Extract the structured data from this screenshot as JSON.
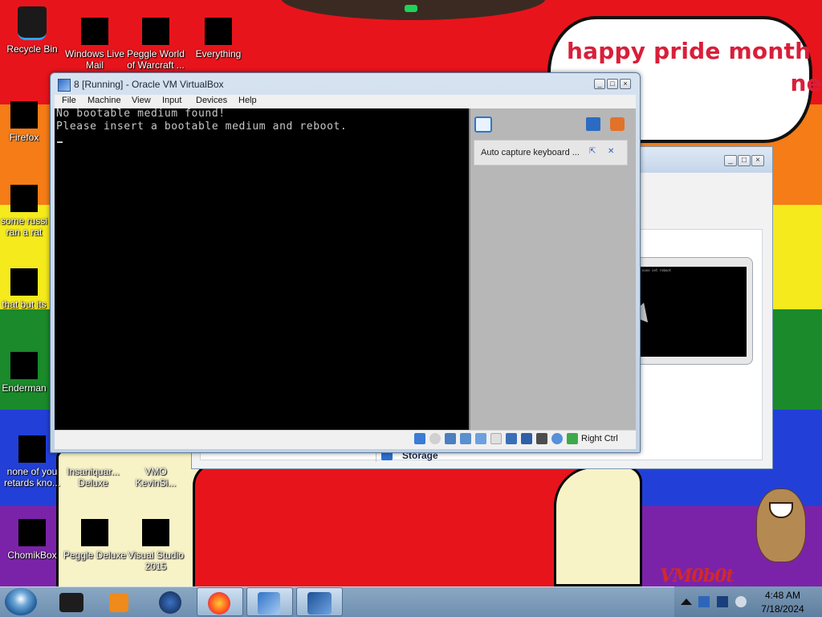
{
  "wallpaper": {
    "speech_bubble": "happy pride month\n                            ne!",
    "watermark": "VM0b0t"
  },
  "desktop_icons": [
    {
      "label": "Recycle Bin",
      "icon": "recycle-bin-icon"
    },
    {
      "label": "Windows Live\nMail",
      "icon": "mail-icon"
    },
    {
      "label": "Peggle World\nof Warcraft ...",
      "icon": "peggle-icon"
    },
    {
      "label": "Everything",
      "icon": "search-icon"
    },
    {
      "label": "Firefox",
      "icon": "firefox-icon"
    },
    {
      "label": "some russi\nran a rat",
      "icon": "shortcut-icon"
    },
    {
      "label": "that but its",
      "icon": "shortcut-icon"
    },
    {
      "label": "Enderman",
      "icon": "shortcut-icon"
    },
    {
      "label": "none of you\nretards kno...",
      "icon": "shortcut-icon"
    },
    {
      "label": "Insaniquar...\nDeluxe",
      "icon": "game-icon"
    },
    {
      "label": "VMO\nKevinSi...",
      "icon": "shortcut-icon"
    },
    {
      "label": "ChomikBox",
      "icon": "chomikbox-icon"
    },
    {
      "label": "Peggle Deluxe",
      "icon": "peggle-icon"
    },
    {
      "label": "Visual Studio\n2015",
      "icon": "visual-studio-icon"
    }
  ],
  "background_window": {
    "storage_label": "Storage",
    "preview_text": "none set reboot"
  },
  "vbox": {
    "title": "8 [Running] - Oracle VM VirtualBox",
    "menu": [
      "File",
      "Machine",
      "View",
      "Input",
      "Devices",
      "Help"
    ],
    "screen_text": "No bootable medium found!\nPlease insert a bootable medium and reboot.",
    "notice": "Auto capture keyboard ...",
    "host_key": "Right Ctrl"
  },
  "taskbar": {
    "clock_time": "4:48 AM",
    "clock_date": "7/18/2024",
    "buttons": [
      "explorer",
      "media-player",
      "globe",
      "firefox",
      "virtualbox",
      "vm-8"
    ]
  },
  "colors": {
    "accent": "#2d78c8",
    "speech_text": "#d81f3a"
  }
}
